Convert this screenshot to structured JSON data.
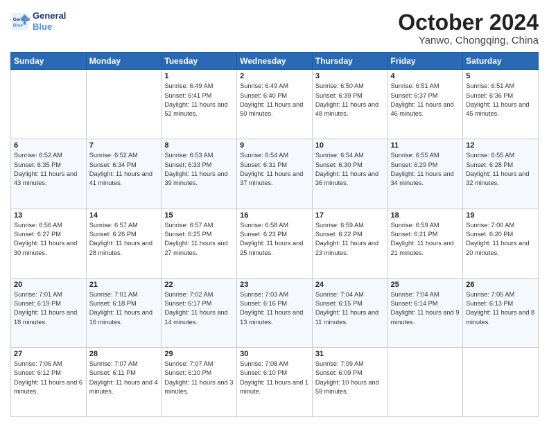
{
  "header": {
    "logo_line1": "General",
    "logo_line2": "Blue",
    "month_title": "October 2024",
    "location": "Yanwo, Chongqing, China"
  },
  "weekdays": [
    "Sunday",
    "Monday",
    "Tuesday",
    "Wednesday",
    "Thursday",
    "Friday",
    "Saturday"
  ],
  "weeks": [
    [
      {
        "day": "",
        "sunrise": "",
        "sunset": "",
        "daylight": ""
      },
      {
        "day": "",
        "sunrise": "",
        "sunset": "",
        "daylight": ""
      },
      {
        "day": "1",
        "sunrise": "Sunrise: 6:49 AM",
        "sunset": "Sunset: 6:41 PM",
        "daylight": "Daylight: 11 hours and 52 minutes."
      },
      {
        "day": "2",
        "sunrise": "Sunrise: 6:49 AM",
        "sunset": "Sunset: 6:40 PM",
        "daylight": "Daylight: 11 hours and 50 minutes."
      },
      {
        "day": "3",
        "sunrise": "Sunrise: 6:50 AM",
        "sunset": "Sunset: 6:39 PM",
        "daylight": "Daylight: 11 hours and 48 minutes."
      },
      {
        "day": "4",
        "sunrise": "Sunrise: 6:51 AM",
        "sunset": "Sunset: 6:37 PM",
        "daylight": "Daylight: 11 hours and 46 minutes."
      },
      {
        "day": "5",
        "sunrise": "Sunrise: 6:51 AM",
        "sunset": "Sunset: 6:36 PM",
        "daylight": "Daylight: 11 hours and 45 minutes."
      }
    ],
    [
      {
        "day": "6",
        "sunrise": "Sunrise: 6:52 AM",
        "sunset": "Sunset: 6:35 PM",
        "daylight": "Daylight: 11 hours and 43 minutes."
      },
      {
        "day": "7",
        "sunrise": "Sunrise: 6:52 AM",
        "sunset": "Sunset: 6:34 PM",
        "daylight": "Daylight: 11 hours and 41 minutes."
      },
      {
        "day": "8",
        "sunrise": "Sunrise: 6:53 AM",
        "sunset": "Sunset: 6:33 PM",
        "daylight": "Daylight: 11 hours and 39 minutes."
      },
      {
        "day": "9",
        "sunrise": "Sunrise: 6:54 AM",
        "sunset": "Sunset: 6:31 PM",
        "daylight": "Daylight: 11 hours and 37 minutes."
      },
      {
        "day": "10",
        "sunrise": "Sunrise: 6:54 AM",
        "sunset": "Sunset: 6:30 PM",
        "daylight": "Daylight: 11 hours and 36 minutes."
      },
      {
        "day": "11",
        "sunrise": "Sunrise: 6:55 AM",
        "sunset": "Sunset: 6:29 PM",
        "daylight": "Daylight: 11 hours and 34 minutes."
      },
      {
        "day": "12",
        "sunrise": "Sunrise: 6:55 AM",
        "sunset": "Sunset: 6:28 PM",
        "daylight": "Daylight: 11 hours and 32 minutes."
      }
    ],
    [
      {
        "day": "13",
        "sunrise": "Sunrise: 6:56 AM",
        "sunset": "Sunset: 6:27 PM",
        "daylight": "Daylight: 11 hours and 30 minutes."
      },
      {
        "day": "14",
        "sunrise": "Sunrise: 6:57 AM",
        "sunset": "Sunset: 6:26 PM",
        "daylight": "Daylight: 11 hours and 28 minutes."
      },
      {
        "day": "15",
        "sunrise": "Sunrise: 6:57 AM",
        "sunset": "Sunset: 6:25 PM",
        "daylight": "Daylight: 11 hours and 27 minutes."
      },
      {
        "day": "16",
        "sunrise": "Sunrise: 6:58 AM",
        "sunset": "Sunset: 6:23 PM",
        "daylight": "Daylight: 11 hours and 25 minutes."
      },
      {
        "day": "17",
        "sunrise": "Sunrise: 6:59 AM",
        "sunset": "Sunset: 6:22 PM",
        "daylight": "Daylight: 11 hours and 23 minutes."
      },
      {
        "day": "18",
        "sunrise": "Sunrise: 6:59 AM",
        "sunset": "Sunset: 6:21 PM",
        "daylight": "Daylight: 11 hours and 21 minutes."
      },
      {
        "day": "19",
        "sunrise": "Sunrise: 7:00 AM",
        "sunset": "Sunset: 6:20 PM",
        "daylight": "Daylight: 11 hours and 20 minutes."
      }
    ],
    [
      {
        "day": "20",
        "sunrise": "Sunrise: 7:01 AM",
        "sunset": "Sunset: 6:19 PM",
        "daylight": "Daylight: 11 hours and 18 minutes."
      },
      {
        "day": "21",
        "sunrise": "Sunrise: 7:01 AM",
        "sunset": "Sunset: 6:18 PM",
        "daylight": "Daylight: 11 hours and 16 minutes."
      },
      {
        "day": "22",
        "sunrise": "Sunrise: 7:02 AM",
        "sunset": "Sunset: 6:17 PM",
        "daylight": "Daylight: 11 hours and 14 minutes."
      },
      {
        "day": "23",
        "sunrise": "Sunrise: 7:03 AM",
        "sunset": "Sunset: 6:16 PM",
        "daylight": "Daylight: 11 hours and 13 minutes."
      },
      {
        "day": "24",
        "sunrise": "Sunrise: 7:04 AM",
        "sunset": "Sunset: 6:15 PM",
        "daylight": "Daylight: 11 hours and 11 minutes."
      },
      {
        "day": "25",
        "sunrise": "Sunrise: 7:04 AM",
        "sunset": "Sunset: 6:14 PM",
        "daylight": "Daylight: 11 hours and 9 minutes."
      },
      {
        "day": "26",
        "sunrise": "Sunrise: 7:05 AM",
        "sunset": "Sunset: 6:13 PM",
        "daylight": "Daylight: 11 hours and 8 minutes."
      }
    ],
    [
      {
        "day": "27",
        "sunrise": "Sunrise: 7:06 AM",
        "sunset": "Sunset: 6:12 PM",
        "daylight": "Daylight: 11 hours and 6 minutes."
      },
      {
        "day": "28",
        "sunrise": "Sunrise: 7:07 AM",
        "sunset": "Sunset: 6:11 PM",
        "daylight": "Daylight: 11 hours and 4 minutes."
      },
      {
        "day": "29",
        "sunrise": "Sunrise: 7:07 AM",
        "sunset": "Sunset: 6:10 PM",
        "daylight": "Daylight: 11 hours and 3 minutes."
      },
      {
        "day": "30",
        "sunrise": "Sunrise: 7:08 AM",
        "sunset": "Sunset: 6:10 PM",
        "daylight": "Daylight: 11 hours and 1 minute."
      },
      {
        "day": "31",
        "sunrise": "Sunrise: 7:09 AM",
        "sunset": "Sunset: 6:09 PM",
        "daylight": "Daylight: 10 hours and 59 minutes."
      },
      {
        "day": "",
        "sunrise": "",
        "sunset": "",
        "daylight": ""
      },
      {
        "day": "",
        "sunrise": "",
        "sunset": "",
        "daylight": ""
      }
    ]
  ]
}
